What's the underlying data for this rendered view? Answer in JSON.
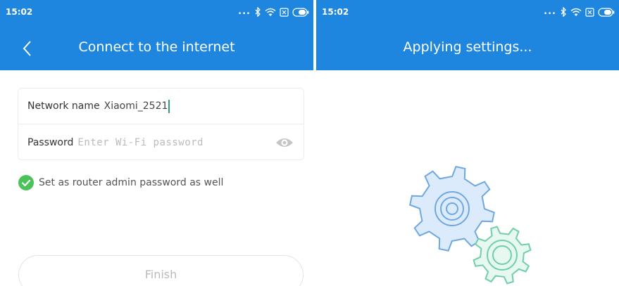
{
  "left_screen": {
    "status_bar": {
      "time": "15:02",
      "dots": "..."
    },
    "app_bar": {
      "title": "Connect to the internet"
    },
    "network_field": {
      "label": "Network name",
      "value": "Xiaomi_2521"
    },
    "password_field": {
      "label": "Password",
      "placeholder": "Enter Wi-Fi password"
    },
    "admin_checkbox": {
      "label": "Set as router admin password as well",
      "checked": true
    },
    "finish_button": {
      "label": "Finish"
    }
  },
  "right_screen": {
    "status_bar": {
      "time": "15:02",
      "dots": "..."
    },
    "app_bar": {
      "title": "Applying settings..."
    }
  },
  "colors": {
    "accent": "#1f86e0",
    "check": "#4cc35a",
    "gear_blue": "#6fa8e0",
    "gear_green": "#6fcfaa",
    "cursor": "#2aa184"
  },
  "icons": [
    "back-arrow-icon",
    "bluetooth-icon",
    "wifi-icon",
    "sim-icon",
    "battery-icon",
    "eye-icon",
    "check-circle-icon",
    "gears-icon"
  ]
}
